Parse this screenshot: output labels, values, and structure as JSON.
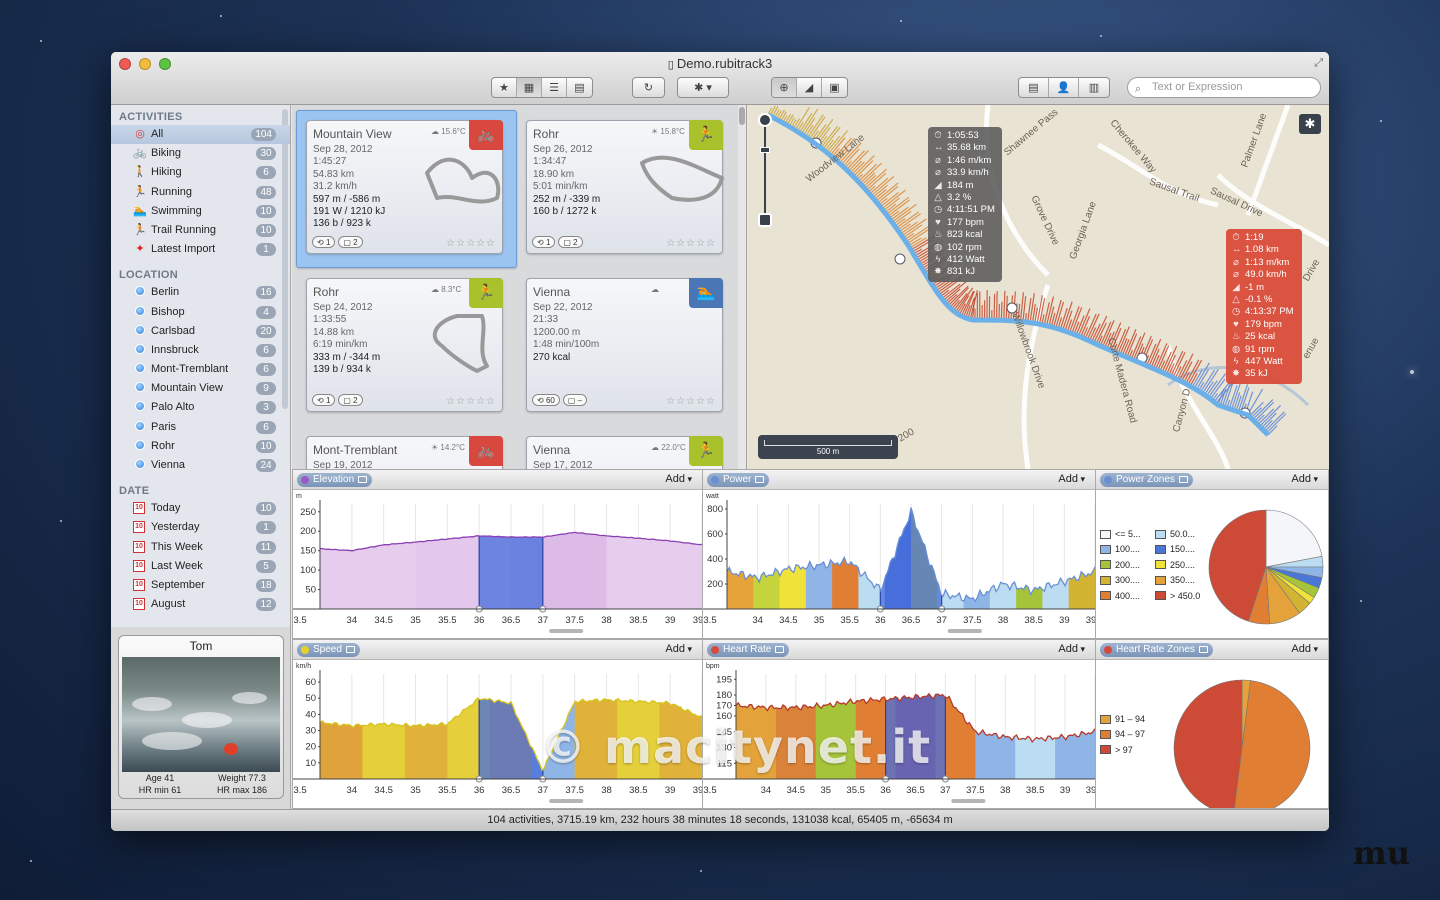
{
  "window": {
    "title": "Demo.rubitrack3"
  },
  "toolbar": {
    "view_buttons": [
      "★",
      "▦",
      "☰",
      "▤"
    ],
    "sync_icon": "↻",
    "gear_icon": "✱",
    "panel_buttons": [
      "⊕",
      "◢",
      "▣"
    ],
    "right_buttons": [
      "▤",
      "👤",
      "▥"
    ],
    "search_placeholder": "Text or Expression"
  },
  "sidebar": {
    "activities_header": "ACTIVITIES",
    "activities": [
      {
        "label": "All",
        "count": "104",
        "icon": "target-icon",
        "glyph": "◎",
        "color": "#d93b3b"
      },
      {
        "label": "Biking",
        "count": "30",
        "icon": "biking-icon",
        "glyph": "🚲",
        "color": "#333"
      },
      {
        "label": "Hiking",
        "count": "6",
        "icon": "hiking-icon",
        "glyph": "🚶",
        "color": "#333"
      },
      {
        "label": "Running",
        "count": "48",
        "icon": "running-icon",
        "glyph": "🏃",
        "color": "#333"
      },
      {
        "label": "Swimming",
        "count": "10",
        "icon": "swimming-icon",
        "glyph": "🏊",
        "color": "#333"
      },
      {
        "label": "Trail Running",
        "count": "10",
        "icon": "trail-running-icon",
        "glyph": "🏃",
        "color": "#333"
      },
      {
        "label": "Latest Import",
        "count": "1",
        "icon": "latest-import-icon",
        "glyph": "✦",
        "color": "#e02020"
      }
    ],
    "location_header": "LOCATION",
    "locations": [
      {
        "label": "Berlin",
        "count": "16"
      },
      {
        "label": "Bishop",
        "count": "4"
      },
      {
        "label": "Carlsbad",
        "count": "20"
      },
      {
        "label": "Innsbruck",
        "count": "6"
      },
      {
        "label": "Mont-Tremblant",
        "count": "6"
      },
      {
        "label": "Mountain View",
        "count": "9"
      },
      {
        "label": "Palo Alto",
        "count": "3"
      },
      {
        "label": "Paris",
        "count": "6"
      },
      {
        "label": "Rohr",
        "count": "10"
      },
      {
        "label": "Vienna",
        "count": "24"
      }
    ],
    "date_header": "DATE",
    "dates": [
      {
        "label": "Today",
        "count": "10"
      },
      {
        "label": "Yesterday",
        "count": "1"
      },
      {
        "label": "This Week",
        "count": "11"
      },
      {
        "label": "Last Week",
        "count": "5"
      },
      {
        "label": "September",
        "count": "18"
      },
      {
        "label": "August",
        "count": "12"
      }
    ],
    "calendar_glyph": "10"
  },
  "profile": {
    "name": "Tom",
    "age": "Age 41",
    "weight": "Weight  77.3",
    "hr_min": "HR min 61",
    "hr_max": "HR max  186"
  },
  "cards": [
    {
      "title": "Mountain View",
      "weather": "☁ 15.6°C",
      "sport": "🚲",
      "sport_color": "#d9483f",
      "lines": [
        "Sep 28, 2012",
        "1:45:27",
        "54.83 km",
        "31.2 km/h",
        "597 m / -586 m",
        "191 W / 1210 kJ",
        "136 b / 923 k"
      ],
      "chip1": "1",
      "chip2": "2",
      "stars": "☆☆☆☆☆"
    },
    {
      "title": "Rohr",
      "weather": "☀ 15.8°C",
      "sport": "🏃",
      "sport_color": "#a9c22c",
      "lines": [
        "Sep 26, 2012",
        "1:34:47",
        "18.90 km",
        "5:01 min/km",
        "252 m / -339 m",
        "160 b / 1272 k"
      ],
      "chip1": "1",
      "chip2": "2",
      "stars": "☆☆☆☆☆"
    },
    {
      "title": "Rohr",
      "weather": "☁ 8.3°C",
      "sport": "🏃",
      "sport_color": "#a9c22c",
      "lines": [
        "Sep 24, 2012",
        "1:33:55",
        "14.88 km",
        "6:19 min/km",
        "333 m / -344 m",
        "139 b / 934 k"
      ],
      "chip1": "1",
      "chip2": "2",
      "stars": "☆☆☆☆☆"
    },
    {
      "title": "Vienna",
      "weather": "☁",
      "sport": "🏊",
      "sport_color": "#4b76b6",
      "lines": [
        "Sep 22, 2012",
        "21:33",
        "1200.00 m",
        "1:48 min/100m",
        "270 kcal"
      ],
      "chip1": "60",
      "chip2": "–",
      "stars": "☆☆☆☆☆"
    },
    {
      "title": "Mont-Tremblant",
      "weather": "☀ 14.2°C",
      "sport": "🚲",
      "sport_color": "#d9483f",
      "lines": [
        "Sep 19, 2012"
      ],
      "chip1": "",
      "chip2": "",
      "stars": ""
    },
    {
      "title": "Vienna",
      "weather": "☁ 22.0°C",
      "sport": "🏃",
      "sport_color": "#a9c22c",
      "lines": [
        "Sep 17, 2012"
      ],
      "chip1": "",
      "chip2": "",
      "stars": ""
    }
  ],
  "map": {
    "streets": [
      "Woodview Lane",
      "Shawnee Pass",
      "Cherokee Way",
      "Palmer Lane",
      "Sausal Trail",
      "Sausal Drive",
      "Grove Drive",
      "Georgia Lane",
      "Willowbrook Drive",
      "Corte Madera Road",
      "Canyon D",
      "Drive",
      "enue",
      "200"
    ],
    "scale": "500 m",
    "info1": [
      {
        "g": "⏱",
        "v": "1:05:53"
      },
      {
        "g": "↔",
        "v": "35.68 km"
      },
      {
        "g": "⌀",
        "v": "1:46 m/km"
      },
      {
        "g": "⌀",
        "v": "33.9 km/h"
      },
      {
        "g": "◢",
        "v": "184 m"
      },
      {
        "g": "△",
        "v": "3.2 %"
      },
      {
        "g": "◷",
        "v": "4:11:51 PM"
      },
      {
        "g": "♥",
        "v": "177 bpm"
      },
      {
        "g": "♨",
        "v": "823 kcal"
      },
      {
        "g": "◍",
        "v": "102 rpm"
      },
      {
        "g": "ϟ",
        "v": "412 Watt"
      },
      {
        "g": "✸",
        "v": "831 kJ"
      }
    ],
    "info2": [
      {
        "g": "⏱",
        "v": "1:19"
      },
      {
        "g": "↔",
        "v": "1.08 km"
      },
      {
        "g": "⌀",
        "v": "1:13 m/km"
      },
      {
        "g": "⌀",
        "v": "49.0 km/h"
      },
      {
        "g": "◢",
        "v": "-1 m"
      },
      {
        "g": "△",
        "v": "-0.1 %"
      },
      {
        "g": "◷",
        "v": "4:13:37 PM"
      },
      {
        "g": "♥",
        "v": "179 bpm"
      },
      {
        "g": "♨",
        "v": "25 kcal"
      },
      {
        "g": "◍",
        "v": "91 rpm"
      },
      {
        "g": "ϟ",
        "v": "447 Watt"
      },
      {
        "g": "✸",
        "v": "35 kJ"
      }
    ]
  },
  "panels": {
    "elevation": {
      "title": "Elevation",
      "add": "Add",
      "unit": "m",
      "dot": "#9a5cc4"
    },
    "power": {
      "title": "Power",
      "add": "Add",
      "unit": "watt",
      "dot": "#6a8fd4"
    },
    "power_zones": {
      "title": "Power Zones",
      "add": "Add",
      "dot": "#6a8fd4"
    },
    "speed": {
      "title": "Speed",
      "add": "Add",
      "unit": "km/h",
      "dot": "#e5d12a"
    },
    "heart_rate": {
      "title": "Heart Rate",
      "add": "Add",
      "unit": "bpm",
      "dot": "#d64a3c"
    },
    "hr_zones": {
      "title": "Heart Rate Zones",
      "add": "Add",
      "dot": "#d64a3c"
    }
  },
  "chart_data": [
    {
      "type": "area",
      "title": "Elevation",
      "ylabel": "m",
      "ylim": [
        0,
        270
      ],
      "yticks": [
        50,
        100,
        150,
        200,
        250
      ],
      "x": [
        33.5,
        34,
        34.5,
        35,
        35.5,
        36,
        36.5,
        37,
        37.5,
        38,
        38.5,
        39,
        39.5
      ],
      "xtick_labels": [
        "3.5",
        "34",
        "34.5",
        "35",
        "35.5",
        "36",
        "36.5",
        "37",
        "37.5",
        "38",
        "38.5",
        "39",
        "39.5"
      ],
      "values": [
        155,
        150,
        165,
        172,
        180,
        188,
        185,
        185,
        197,
        188,
        182,
        175,
        165
      ],
      "selection": [
        36,
        37
      ]
    },
    {
      "type": "area",
      "title": "Power",
      "ylabel": "watt",
      "ylim": [
        0,
        840
      ],
      "yticks": [
        200,
        400,
        600,
        800
      ],
      "x": [
        33.5,
        34,
        34.5,
        35,
        35.5,
        36,
        36.5,
        37,
        37.5,
        38,
        38.5,
        39,
        39.5
      ],
      "xtick_labels": [
        "3.5",
        "34",
        "34.5",
        "35",
        "35.5",
        "36",
        "36.5",
        "37",
        "37.5",
        "38",
        "38.5",
        "39",
        "39.5"
      ],
      "values": [
        300,
        250,
        320,
        350,
        380,
        150,
        780,
        120,
        80,
        200,
        150,
        220,
        300
      ],
      "selection": [
        36,
        37
      ]
    },
    {
      "type": "pie",
      "title": "Power Zones",
      "categories": [
        "<= 5...",
        "50.0...",
        "100....",
        "150....",
        "200....",
        "250....",
        "300....",
        "350....",
        "400....",
        "> 450.0"
      ],
      "values": [
        22,
        3,
        3,
        3,
        3,
        2,
        4,
        9,
        6,
        45
      ],
      "colors": [
        "#f4f6fa",
        "#bcdcf2",
        "#8fb5e6",
        "#4a76d6",
        "#a6c43a",
        "#f1e23a",
        "#d2b432",
        "#e5a23a",
        "#e07f34",
        "#cd4a36"
      ]
    },
    {
      "type": "area",
      "title": "Speed",
      "ylabel": "km/h",
      "ylim": [
        0,
        65
      ],
      "yticks": [
        10,
        20,
        30,
        40,
        50,
        60
      ],
      "x": [
        33.5,
        34,
        34.5,
        35,
        35.5,
        36,
        36.5,
        37,
        37.5,
        38,
        38.5,
        39,
        39.5
      ],
      "xtick_labels": [
        "3.5",
        "34",
        "34.5",
        "35",
        "35.5",
        "36",
        "36.5",
        "37",
        "37.5",
        "38",
        "38.5",
        "39",
        "39.5"
      ],
      "values": [
        35,
        33,
        34,
        33,
        34,
        50,
        47,
        5,
        48,
        49,
        48,
        47,
        38
      ],
      "selection": [
        36,
        37
      ]
    },
    {
      "type": "area",
      "title": "Heart Rate",
      "ylabel": "bpm",
      "ylim": [
        100,
        200
      ],
      "yticks": [
        115,
        130,
        145,
        160,
        170,
        180,
        195
      ],
      "x": [
        33.5,
        34,
        34.5,
        35,
        35.5,
        36,
        36.5,
        37,
        37.5,
        38,
        38.5,
        39,
        39.5
      ],
      "xtick_labels": [
        "3.5",
        "34",
        "34.5",
        "35",
        "35.5",
        "36",
        "36.5",
        "37",
        "37.5",
        "38",
        "38.5",
        "39",
        "39.5"
      ],
      "values": [
        170,
        168,
        168,
        170,
        174,
        176,
        178,
        180,
        145,
        140,
        138,
        140,
        145
      ],
      "selection": [
        36,
        37
      ]
    },
    {
      "type": "pie",
      "title": "Heart Rate Zones",
      "categories": [
        "91 – 94",
        "94 – 97",
        "> 97"
      ],
      "values": [
        2,
        50,
        48
      ],
      "colors": [
        "#e5a23a",
        "#e07f34",
        "#cd4a36"
      ]
    }
  ],
  "status": "104 activities, 3715.19 km, 232 hours 38 minutes 18 seconds, 131038 kcal, 65405 m, -65634 m",
  "watermark": "© macitynet.it",
  "corner_logo": "mu"
}
